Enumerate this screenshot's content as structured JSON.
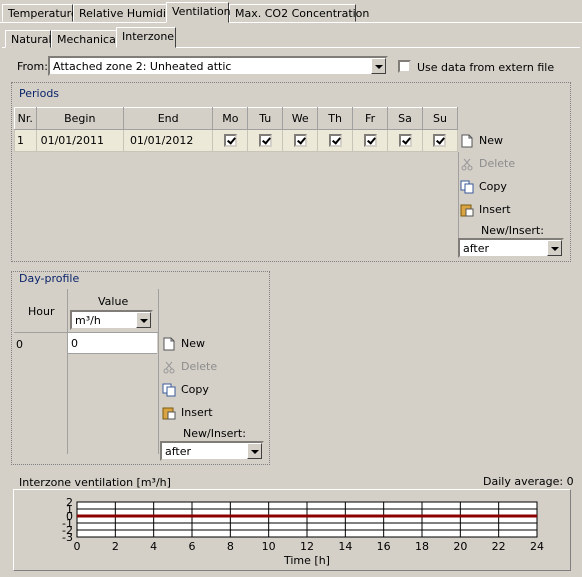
{
  "tabs_main": [
    "Temperature",
    "Relative Humidity",
    "Ventilation",
    "Max. CO2 Concentration"
  ],
  "tabs_sub": [
    "Natural",
    "Mechanical",
    "Interzone"
  ],
  "from": {
    "label": "From:",
    "value": "Attached zone 2: Unheated attic",
    "extern_label": "Use data from extern file",
    "extern_checked": false
  },
  "periods": {
    "title": "Periods",
    "headers": [
      "Nr.",
      "Begin",
      "End",
      "Mo",
      "Tu",
      "We",
      "Th",
      "Fr",
      "Sa",
      "Su"
    ],
    "rows": [
      {
        "nr": "1",
        "begin": "01/01/2011",
        "end": "01/01/2012",
        "days": [
          true,
          true,
          true,
          true,
          true,
          true,
          true
        ]
      }
    ],
    "buttons": {
      "new": "New",
      "delete": "Delete",
      "copy": "Copy",
      "insert": "Insert"
    },
    "new_insert_label": "New/Insert:",
    "new_insert_value": "after"
  },
  "day_profile": {
    "title": "Day-profile",
    "hour_header": "Hour",
    "value_header": "Value",
    "unit": "m³/h",
    "rows": [
      {
        "hour": "0",
        "value": "0"
      }
    ],
    "buttons": {
      "new": "New",
      "delete": "Delete",
      "copy": "Copy",
      "insert": "Insert"
    },
    "new_insert_label": "New/Insert:",
    "new_insert_value": "after"
  },
  "chart_data": {
    "type": "line",
    "title": "Interzone ventilation [m³/h]",
    "daily_average": "Daily average: 0",
    "xlabel": "Time [h]",
    "xlim": [
      0,
      24
    ],
    "ylim": [
      -3,
      2
    ],
    "xticks": [
      0,
      2,
      4,
      6,
      8,
      10,
      12,
      14,
      16,
      18,
      20,
      22,
      24
    ],
    "yticks": [
      2,
      1,
      0,
      -1,
      -2,
      -3
    ],
    "grid": true,
    "series": [
      {
        "color": "#8b0000",
        "x": [
          0,
          24
        ],
        "y": [
          0,
          0
        ]
      }
    ]
  }
}
